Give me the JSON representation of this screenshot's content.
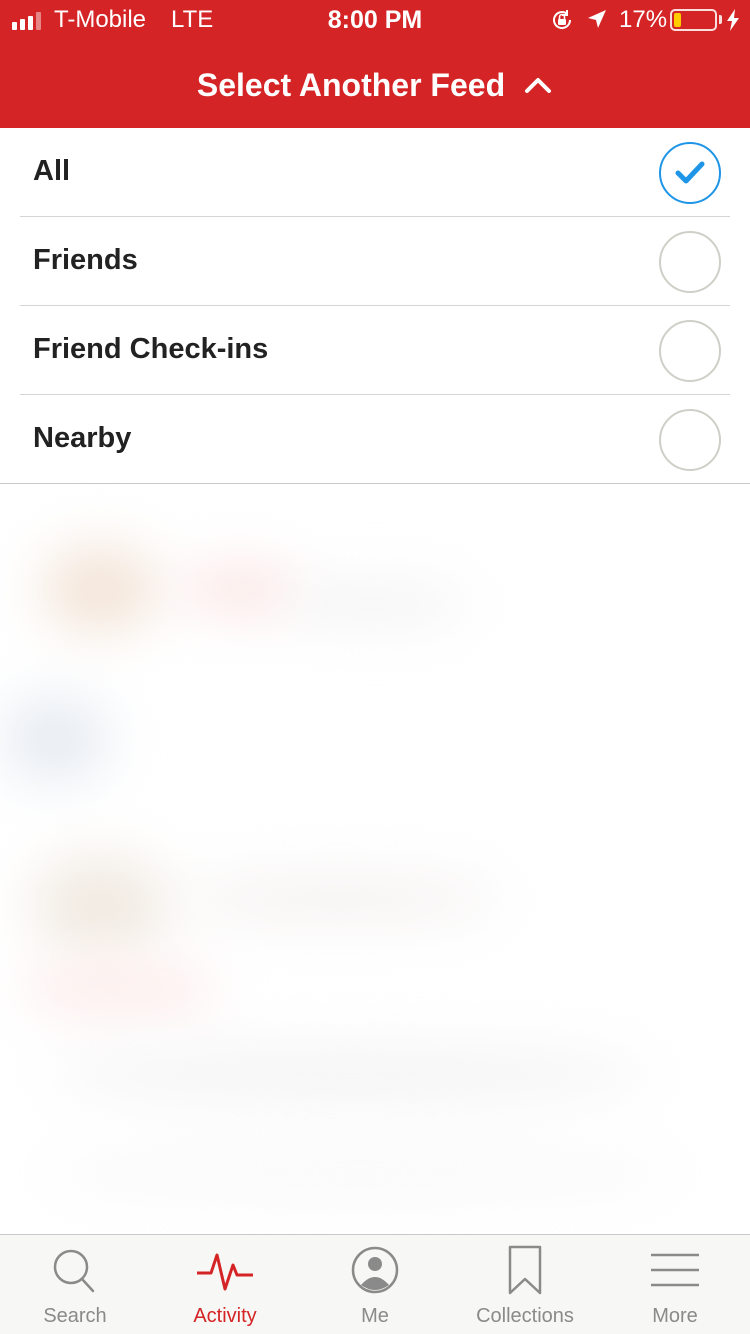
{
  "status_bar": {
    "carrier": "T-Mobile",
    "network": "LTE",
    "time": "8:00 PM",
    "battery_percent": "17%",
    "battery_level": 0.17,
    "icons": [
      "signal-icon",
      "rotation-lock-icon",
      "location-arrow-icon",
      "battery-icon",
      "charging-bolt-icon"
    ]
  },
  "header": {
    "title": "Select Another Feed",
    "chevron_icon": "chevron-up-icon"
  },
  "feed_options": [
    {
      "label": "All",
      "selected": true
    },
    {
      "label": "Friends",
      "selected": false
    },
    {
      "label": "Friend Check-ins",
      "selected": false
    },
    {
      "label": "Nearby",
      "selected": false
    }
  ],
  "tabbar": {
    "tabs": [
      {
        "label": "Search",
        "icon": "search-icon",
        "active": false
      },
      {
        "label": "Activity",
        "icon": "activity-pulse-icon",
        "active": true
      },
      {
        "label": "Me",
        "icon": "user-circle-icon",
        "active": false
      },
      {
        "label": "Collections",
        "icon": "bookmark-icon",
        "active": false
      },
      {
        "label": "More",
        "icon": "menu-lines-icon",
        "active": false
      }
    ]
  },
  "colors": {
    "brand_red": "#d42426",
    "selected_blue": "#1e95e6",
    "radio_border": "#cfcfc8",
    "tab_inactive": "#8a8a8a"
  }
}
